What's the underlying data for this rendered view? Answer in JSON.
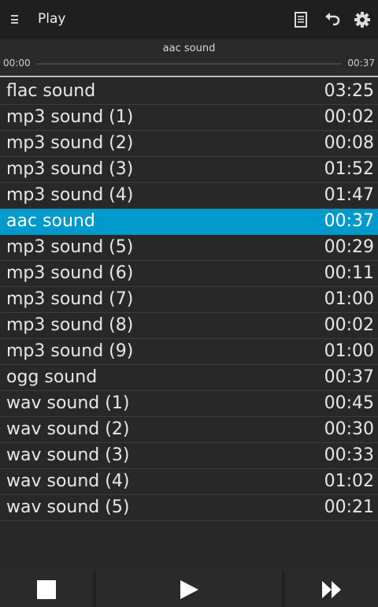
{
  "actionbar": {
    "title": "Play",
    "icons": [
      "menu-icon",
      "playlist-icon",
      "undo-icon",
      "gear-icon"
    ]
  },
  "now_playing": {
    "title": "aac sound",
    "elapsed": "00:00",
    "total": "00:37",
    "progress": 0.0
  },
  "playlist": [
    {
      "name": "flac sound",
      "duration": "03:25",
      "active": false
    },
    {
      "name": "mp3 sound (1)",
      "duration": "00:02",
      "active": false
    },
    {
      "name": "mp3 sound (2)",
      "duration": "00:08",
      "active": false
    },
    {
      "name": "mp3 sound (3)",
      "duration": "01:52",
      "active": false
    },
    {
      "name": "mp3 sound (4)",
      "duration": "01:47",
      "active": false
    },
    {
      "name": "aac sound",
      "duration": "00:37",
      "active": true
    },
    {
      "name": "mp3 sound (5)",
      "duration": "00:29",
      "active": false
    },
    {
      "name": "mp3 sound (6)",
      "duration": "00:11",
      "active": false
    },
    {
      "name": "mp3 sound (7)",
      "duration": "01:00",
      "active": false
    },
    {
      "name": "mp3 sound (8)",
      "duration": "00:02",
      "active": false
    },
    {
      "name": "mp3 sound (9)",
      "duration": "01:00",
      "active": false
    },
    {
      "name": "ogg sound",
      "duration": "00:37",
      "active": false
    },
    {
      "name": "wav sound (1)",
      "duration": "00:45",
      "active": false
    },
    {
      "name": "wav sound (2)",
      "duration": "00:30",
      "active": false
    },
    {
      "name": "wav sound (3)",
      "duration": "00:33",
      "active": false
    },
    {
      "name": "wav sound (4)",
      "duration": "01:02",
      "active": false
    },
    {
      "name": "wav sound (5)",
      "duration": "00:21",
      "active": false
    }
  ],
  "controls": {
    "icons": [
      "stop-icon",
      "play-icon",
      "fast-forward-icon"
    ]
  },
  "colors": {
    "accent": "#0099cc",
    "background": "#282828",
    "bar": "#1f1f1f"
  }
}
